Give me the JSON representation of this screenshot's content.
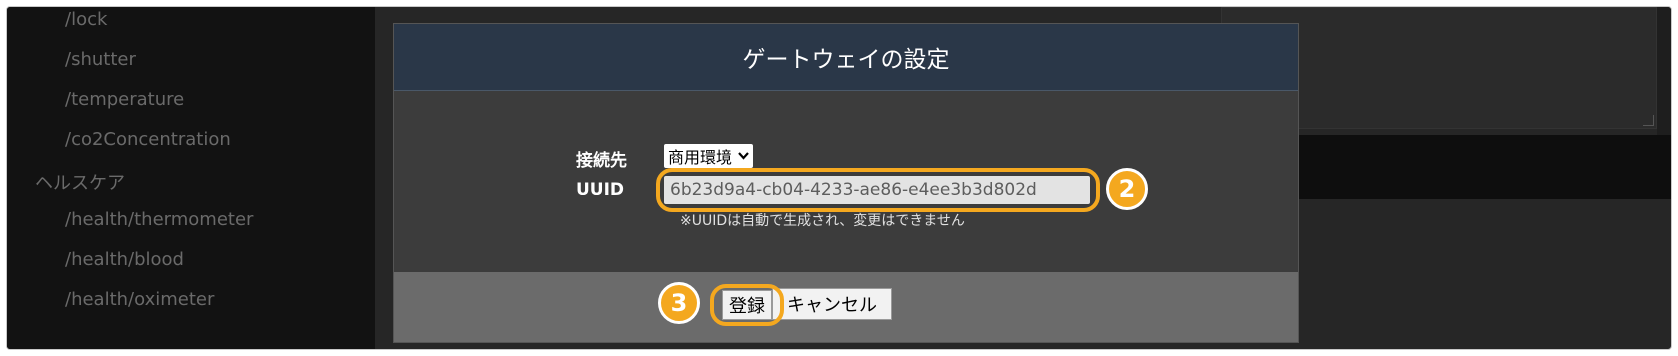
{
  "sidebar": {
    "items": [
      {
        "label": "/lock",
        "type": "item"
      },
      {
        "label": "/shutter",
        "type": "item"
      },
      {
        "label": "/temperature",
        "type": "item"
      },
      {
        "label": "/co2Concentration",
        "type": "item"
      },
      {
        "label": "ヘルスケア",
        "type": "section"
      },
      {
        "label": "/health/thermometer",
        "type": "item"
      },
      {
        "label": "/health/blood",
        "type": "item"
      },
      {
        "label": "/health/oximeter",
        "type": "item"
      }
    ]
  },
  "modal": {
    "title": "ゲートウェイの設定",
    "destination_label": "接続先",
    "destination_value": "商用環境",
    "uuid_label": "UUID",
    "uuid_value": "6b23d9a4-cb04-4233-ae86-e4ee3b3d802d",
    "uuid_note": "※UUIDは自動で生成され、変更はできません",
    "register_label": "登録",
    "cancel_label": "キャンセル"
  },
  "annotations": {
    "step2": "2",
    "step3": "3",
    "color": "#f4a81f"
  }
}
